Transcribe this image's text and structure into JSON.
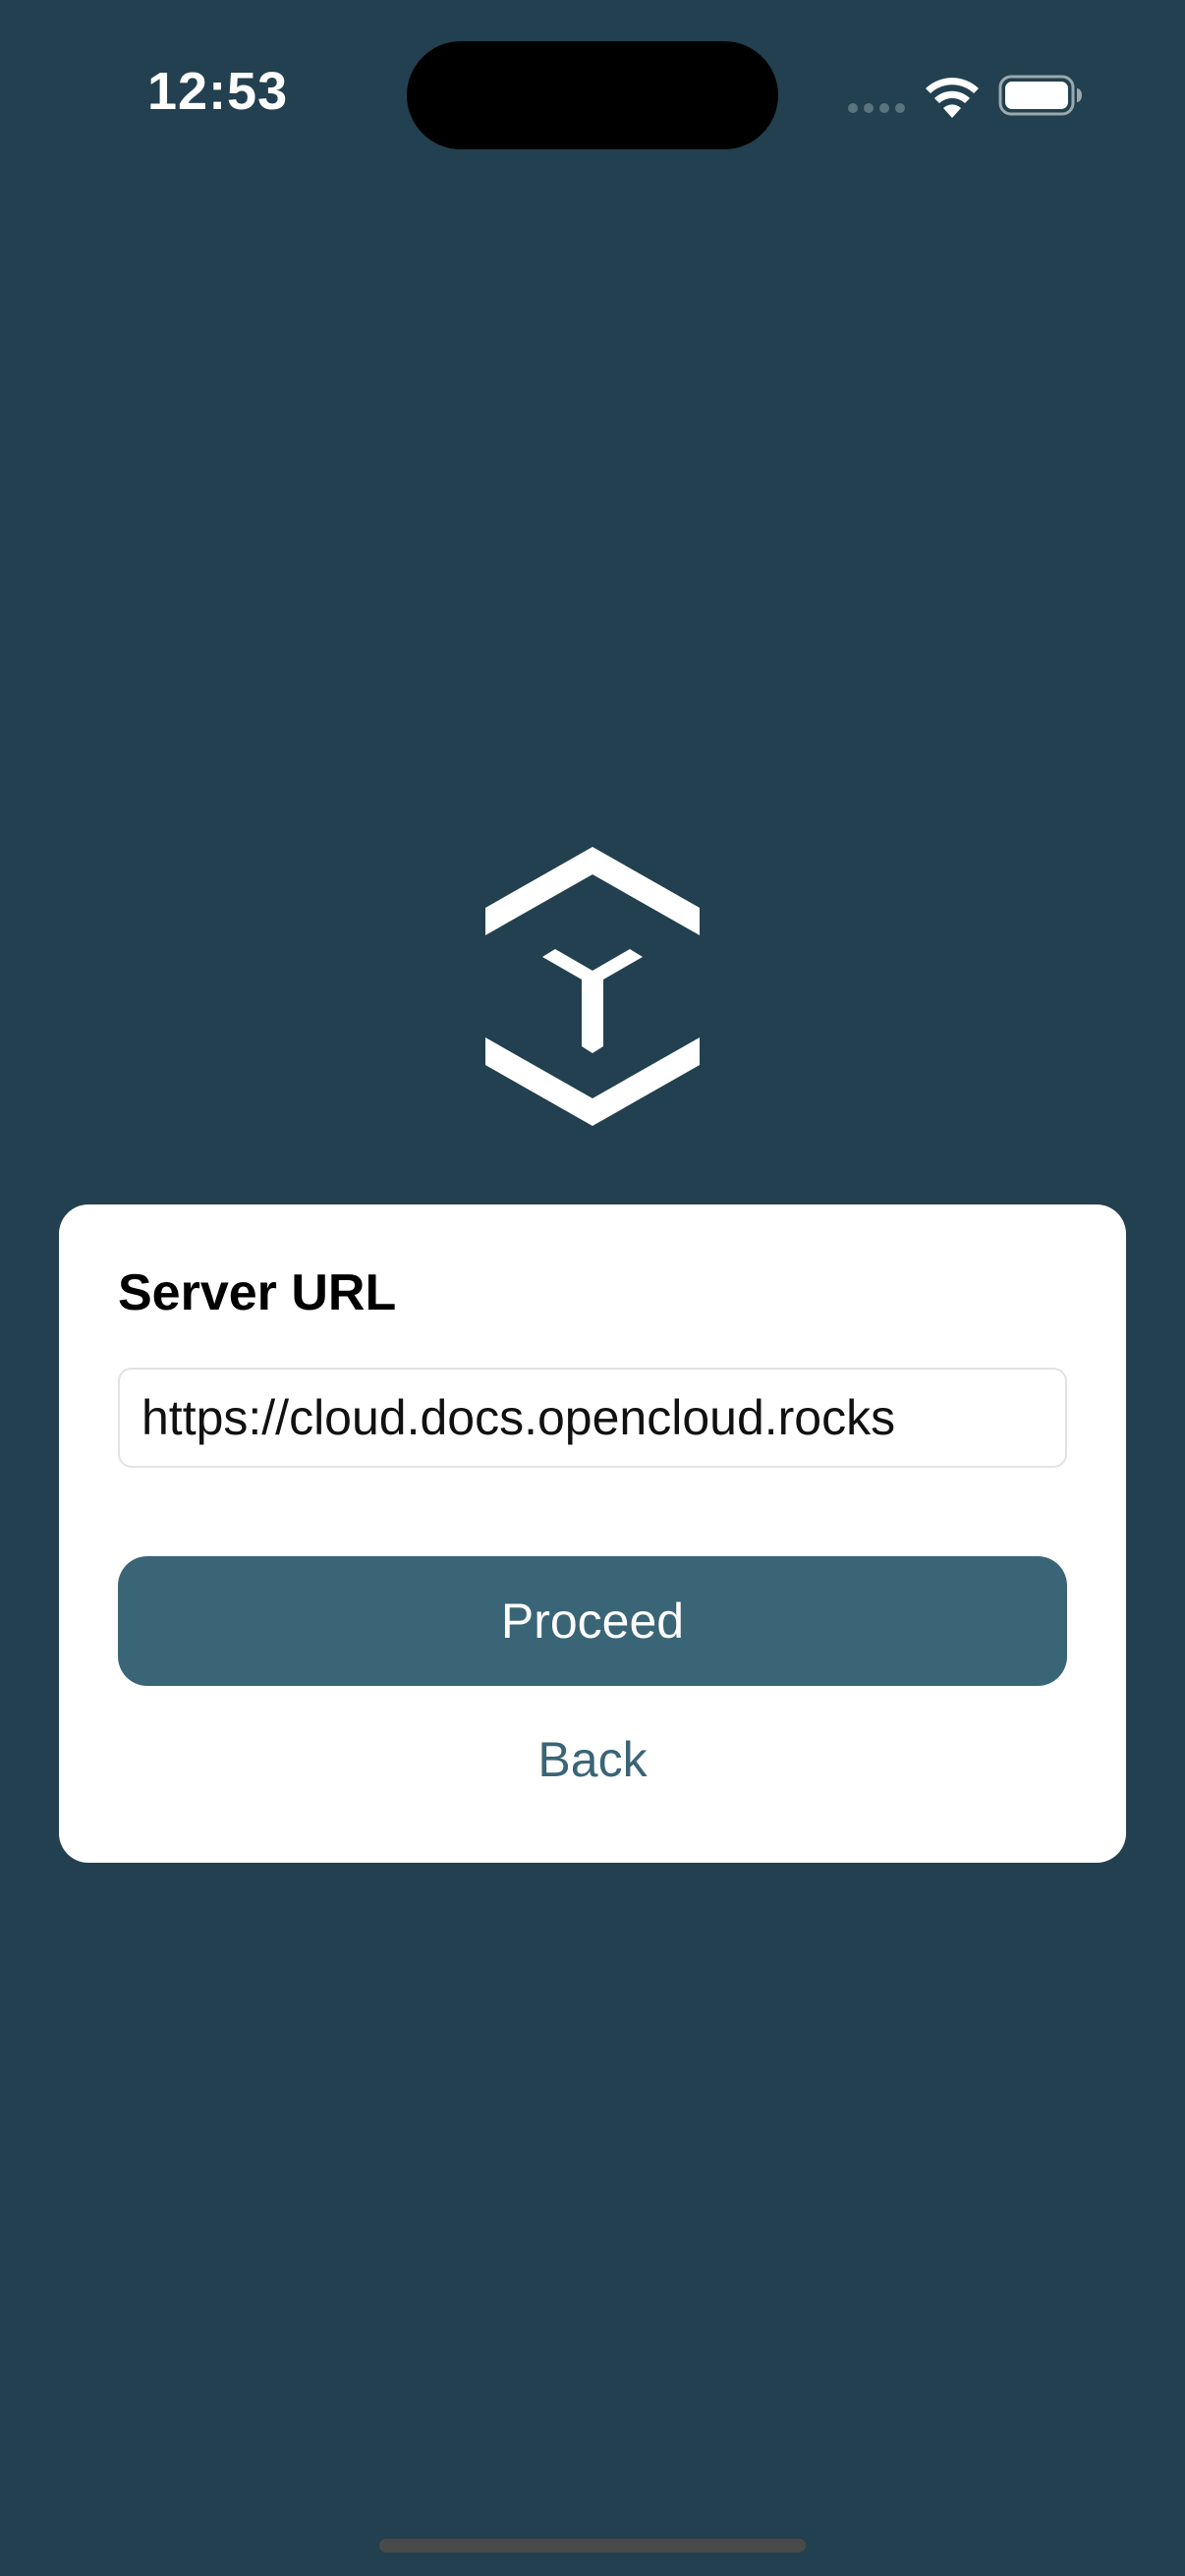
{
  "status_bar": {
    "time": "12:53",
    "icons": [
      "cellular-signal-icon",
      "wifi-icon",
      "battery-icon"
    ]
  },
  "logo": {
    "icon": "opencloud-logo-icon"
  },
  "card": {
    "title": "Server URL",
    "url_value": "https://cloud.docs.opencloud.rocks",
    "proceed_label": "Proceed",
    "back_label": "Back"
  },
  "colors": {
    "background": "#22404f",
    "accent": "#3a6577",
    "card": "#ffffff"
  }
}
